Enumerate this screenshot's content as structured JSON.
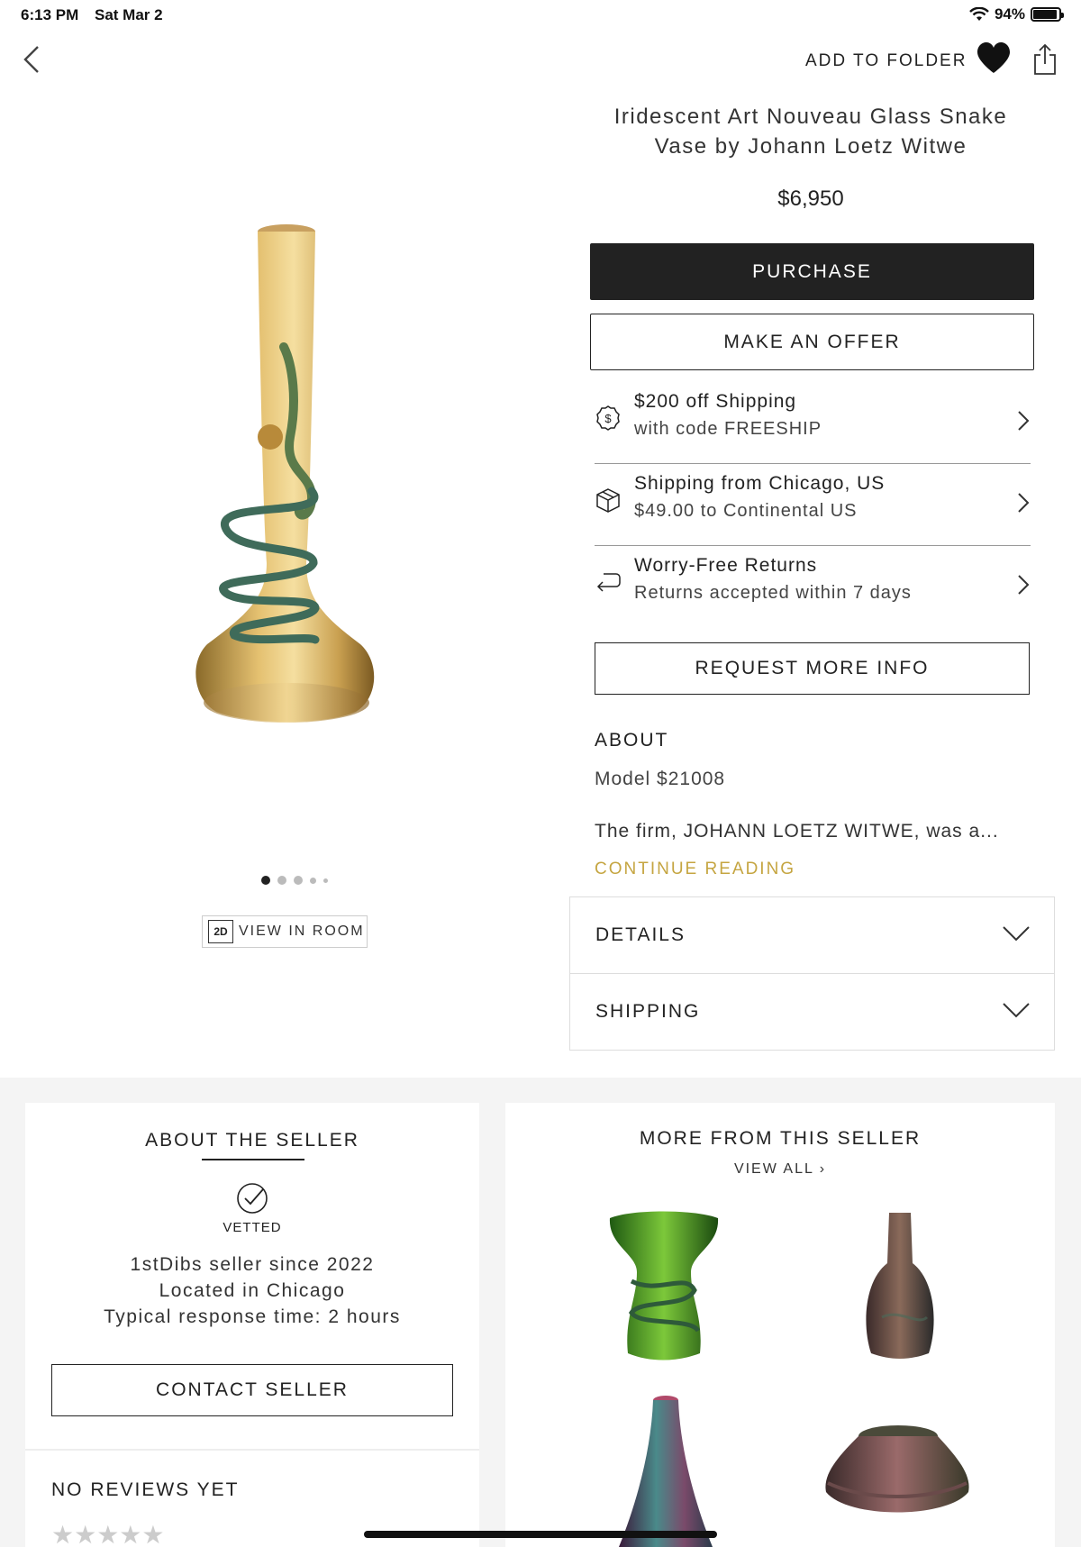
{
  "status_bar": {
    "time": "6:13 PM",
    "date": "Sat Mar 2",
    "battery": "94%",
    "battery_level": 0.94
  },
  "header": {
    "add_to_folder": "ADD TO FOLDER",
    "icons": [
      "back-chevron-icon",
      "heart-icon",
      "share-icon"
    ]
  },
  "product": {
    "title_line1": "Iridescent Art Nouveau Glass Snake",
    "title_line2": "Vase by Johann Loetz Witwe",
    "price": "$6,950",
    "purchase_label": "PURCHASE",
    "offer_label": "MAKE AN OFFER"
  },
  "info_rows": [
    {
      "icon": "dollar-badge-icon",
      "line1": "$200 off Shipping",
      "line2": "with code FREESHIP"
    },
    {
      "icon": "box-icon",
      "line1": "Shipping from Chicago, US",
      "line2": "$49.00 to Continental US"
    },
    {
      "icon": "return-arrow-icon",
      "line1": "Worry-Free Returns",
      "line2": "Returns accepted within 7 days"
    }
  ],
  "request_label": "REQUEST MORE INFO",
  "about": {
    "heading": "ABOUT",
    "model": "Model $21008",
    "description": "The firm, JOHANN LOETZ WITWE, was a...",
    "continue": "CONTINUE READING"
  },
  "accordions": {
    "details": "DETAILS",
    "shipping": "SHIPPING"
  },
  "gallery": {
    "page_count": 5,
    "current_page": 1,
    "view_in_room_icon": "2D",
    "view_in_room": "VIEW IN ROOM"
  },
  "seller": {
    "title": "ABOUT THE SELLER",
    "vetted": "VETTED",
    "line1": "1stDibs seller since 2022",
    "line2": "Located in Chicago",
    "line3": "Typical response time: 2 hours",
    "contact_label": "CONTACT SELLER",
    "reviews_heading": "NO REVIEWS YET",
    "stars": "★★★★★",
    "rating": 0
  },
  "more_from_seller": {
    "title": "MORE FROM THIS SELLER",
    "view_all": "VIEW ALL ›"
  },
  "colors": {
    "accent_gold": "#c5a541",
    "button_dark": "#222222",
    "bottom_bg": "#f4f4f4"
  }
}
